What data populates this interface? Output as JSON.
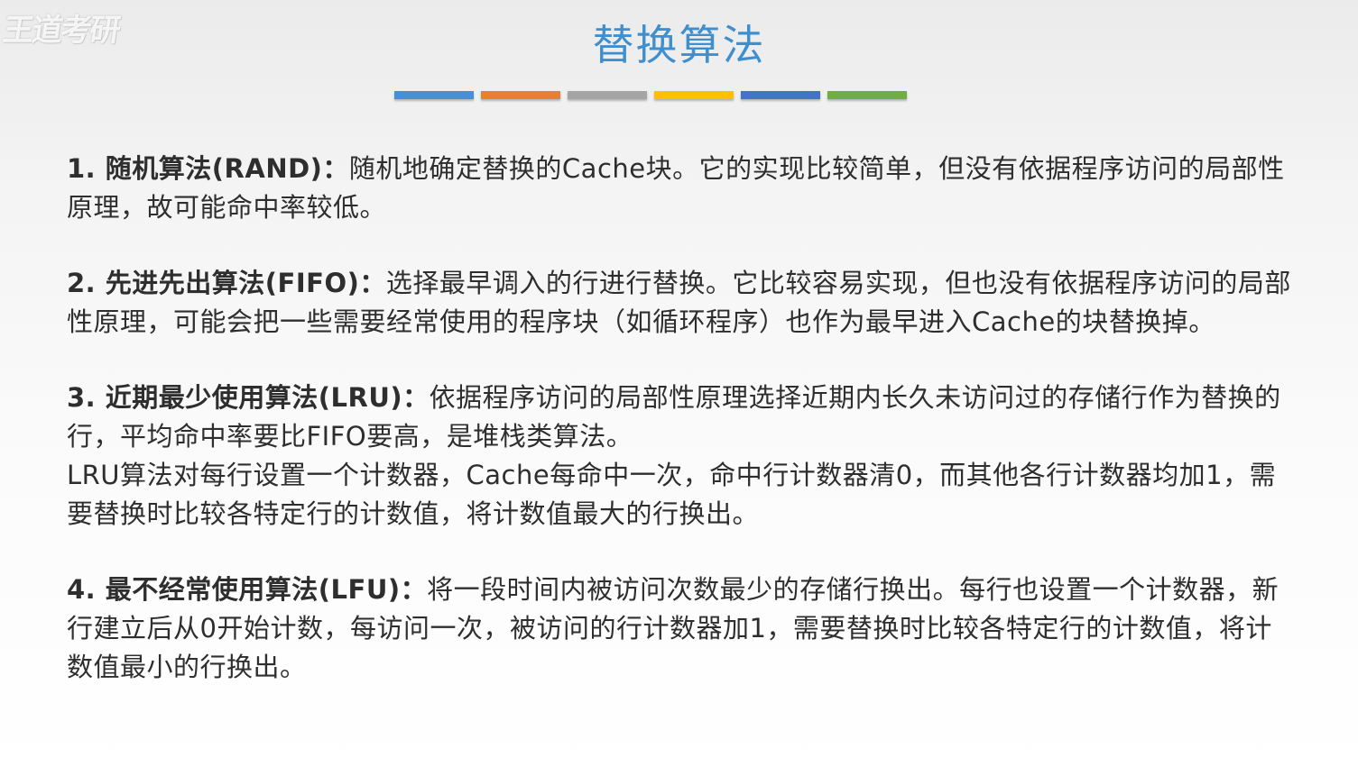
{
  "watermark": "王道考研",
  "title": "替换算法",
  "bars": [
    {
      "color": "#4a8fd6",
      "width": 88
    },
    {
      "color": "#ed7d31",
      "width": 88
    },
    {
      "color": "#a5a5a5",
      "width": 88
    },
    {
      "color": "#ffc000",
      "width": 88
    },
    {
      "color": "#4472c4",
      "width": 88
    },
    {
      "color": "#70ad47",
      "width": 88
    }
  ],
  "paragraphs": [
    {
      "lead": "1. 随机算法(RAND)：",
      "text": "随机地确定替换的Cache块。它的实现比较简单，但没有依据程序访问的局部性原理，故可能命中率较低。",
      "gap": false
    },
    {
      "lead": "2. 先进先出算法(FIFO)：",
      "text": "选择最早调入的行进行替换。它比较容易实现，但也没有依据程序访问的局部性原理，可能会把一些需要经常使用的程序块（如循环程序）也作为最早进入Cache的块替换掉。",
      "gap": true
    },
    {
      "lead": "3. 近期最少使用算法(LRU)：",
      "text": "依据程序访问的局部性原理选择近期内长久未访问过的存储行作为替换的行，平均命中率要比FIFO要高，是堆栈类算法。",
      "gap": true
    },
    {
      "lead": "",
      "text": "LRU算法对每行设置一个计数器，Cache每命中一次，命中行计数器清0，而其他各行计数器均加1，需要替换时比较各特定行的计数值，将计数值最大的行换出。",
      "gap": false
    },
    {
      "lead": "4. 最不经常使用算法(LFU)：",
      "text": "将一段时间内被访问次数最少的存储行换出。每行也设置一个计数器，新行建立后从0开始计数，每访问一次，被访问的行计数器加1，需要替换时比较各特定行的计数值，将计数值最小的行换出。",
      "gap": true
    }
  ]
}
